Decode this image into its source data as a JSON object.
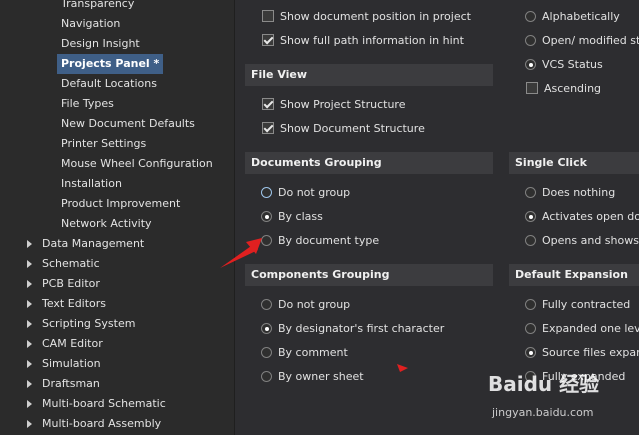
{
  "tree": {
    "children": [
      "Transparency",
      "Navigation",
      "Design Insight",
      "Projects Panel *",
      "Default Locations",
      "File Types",
      "New Document Defaults",
      "Printer Settings",
      "Mouse Wheel Configuration",
      "Installation",
      "Product Improvement",
      "Network Activity"
    ],
    "parents": [
      "Data Management",
      "Schematic",
      "PCB Editor",
      "Text Editors",
      "Scripting System",
      "CAM Editor",
      "Simulation",
      "Draftsman",
      "Multi-board Schematic",
      "Multi-board Assembly"
    ]
  },
  "general": {
    "show_doc_position": "Show document position in project",
    "show_full_path": "Show full path information in hint"
  },
  "file_view": {
    "title": "File View",
    "show_project_structure": "Show Project Structure",
    "show_document_structure": "Show Document Structure"
  },
  "documents_grouping": {
    "title": "Documents Grouping",
    "do_not_group": "Do not group",
    "by_class": "By class",
    "by_document_type": "By document type"
  },
  "components_grouping": {
    "title": "Components Grouping",
    "do_not_group": "Do not group",
    "by_designator": "By designator's first character",
    "by_comment": "By comment",
    "by_owner_sheet": "By owner sheet"
  },
  "sorting": {
    "alphabetically": "Alphabetically",
    "open_modified": "Open/ modified sta",
    "vcs_status": "VCS Status",
    "ascending": "Ascending"
  },
  "single_click": {
    "title": "Single Click",
    "does_nothing": "Does nothing",
    "activates_open": "Activates open doc",
    "opens_and_shows": "Opens and shows"
  },
  "default_expansion": {
    "title": "Default Expansion",
    "fully_contracted": "Fully contracted",
    "expanded_one_level": "Expanded one leve",
    "source_files_expanded": "Source files expanc",
    "fully_expanded": "Fully expanded"
  },
  "watermark": {
    "logo": "Baidu 经验",
    "url": "jingyan.baidu.com"
  },
  "colors": {
    "selected_bg": "#3f5f87",
    "annotation_red": "#e02020"
  }
}
